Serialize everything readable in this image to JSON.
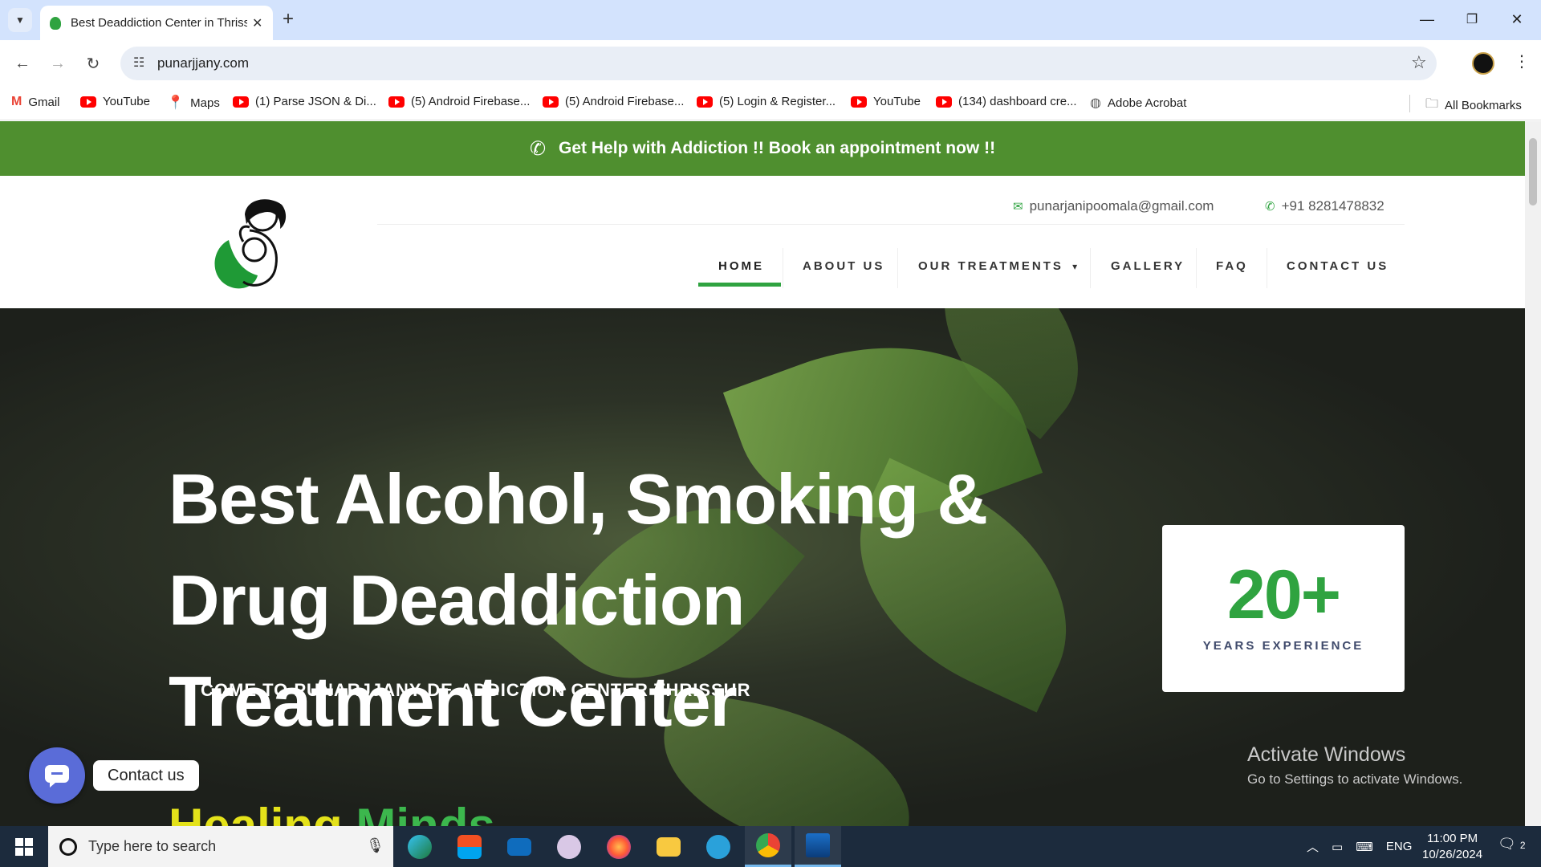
{
  "browser": {
    "tab_title": "Best Deaddiction Center in Thrissur",
    "new_tab_symbol": "+",
    "url": "punarjjany.com",
    "bookmarks": [
      {
        "label": "Gmail",
        "icon": "gmail-icon"
      },
      {
        "label": "YouTube",
        "icon": "youtube-icon"
      },
      {
        "label": "Maps",
        "icon": "maps-icon"
      },
      {
        "label": "(1) Parse JSON & Di...",
        "icon": "youtube-icon"
      },
      {
        "label": "(5) Android Firebase...",
        "icon": "youtube-icon"
      },
      {
        "label": "(5) Android Firebase...",
        "icon": "youtube-icon"
      },
      {
        "label": "(5) Login & Register...",
        "icon": "youtube-icon"
      },
      {
        "label": "YouTube",
        "icon": "youtube-icon"
      },
      {
        "label": "(134) dashboard cre...",
        "icon": "youtube-icon"
      },
      {
        "label": "Adobe Acrobat",
        "icon": "globe-icon"
      }
    ],
    "all_bookmarks": "All Bookmarks"
  },
  "site": {
    "promo_text": "Get Help with Addiction !! Book an appointment now !!",
    "email": "punarjanipoomala@gmail.com",
    "phone": "+91 8281478832",
    "nav": [
      "HOME",
      "ABOUT US",
      "OUR TREATMENTS",
      "GALLERY",
      "FAQ",
      "CONTACT US"
    ],
    "active_nav": "HOME",
    "hero_title_lines": [
      "Best Alcohol, Smoking &",
      "Drug Deaddiction",
      "Treatment Center"
    ],
    "hero_welcome": "COME TO PUNARJJANY DE-ADDICTION CENTER THRISSUR",
    "hero_sub_word1": "Healing",
    "hero_sub_word2": "Minds",
    "experience_number": "20+",
    "experience_label": "YEARS EXPERIENCE",
    "chat_label": "Contact us"
  },
  "watermark": {
    "line1": "Activate Windows",
    "line2": "Go to Settings to activate Windows."
  },
  "taskbar": {
    "search_placeholder": "Type here to search",
    "language": "ENG",
    "time": "11:00 PM",
    "date": "10/26/2024",
    "notifications": "2"
  },
  "colors": {
    "brand_green": "#2fa340",
    "promo_green": "#4f8f2f",
    "chat_blue": "#5a6cd8"
  }
}
